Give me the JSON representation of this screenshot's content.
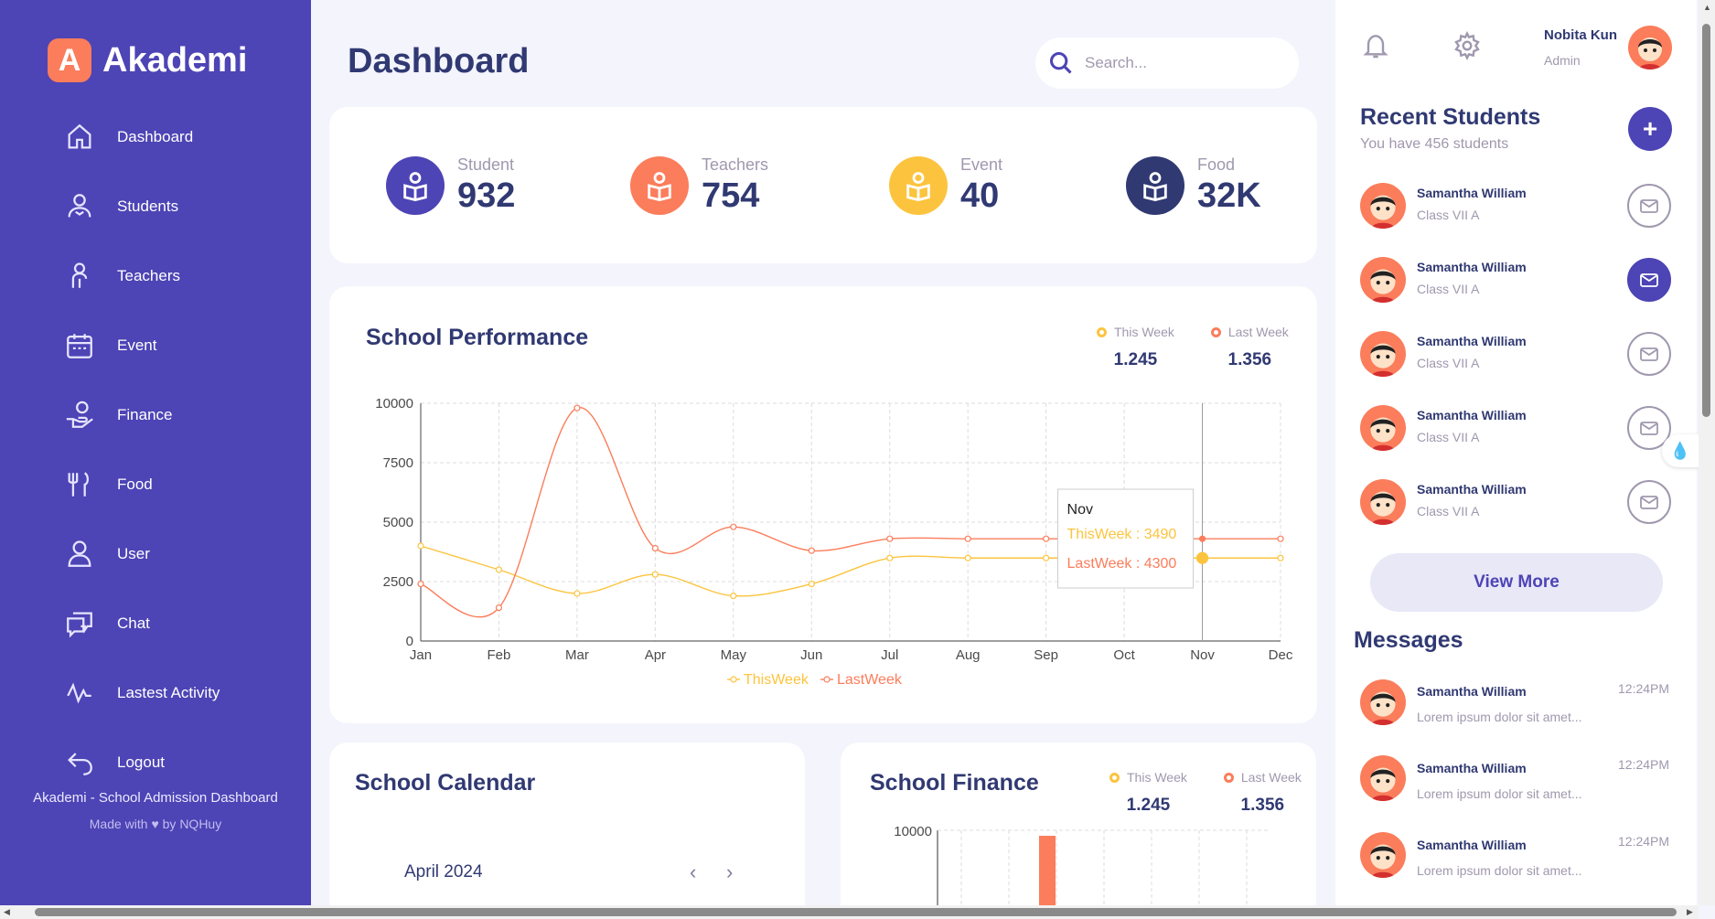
{
  "brand": {
    "logo_letter": "A",
    "name": "Akademi"
  },
  "nav": [
    {
      "label": "Dashboard",
      "icon": "home-icon"
    },
    {
      "label": "Students",
      "icon": "student-icon"
    },
    {
      "label": "Teachers",
      "icon": "teacher-icon"
    },
    {
      "label": "Event",
      "icon": "calendar-icon"
    },
    {
      "label": "Finance",
      "icon": "finance-icon"
    },
    {
      "label": "Food",
      "icon": "food-icon"
    },
    {
      "label": "User",
      "icon": "user-icon"
    },
    {
      "label": "Chat",
      "icon": "chat-icon"
    },
    {
      "label": "Lastest Activity",
      "icon": "activity-icon"
    },
    {
      "label": "Logout",
      "icon": "logout-icon"
    }
  ],
  "sidebar_footer": {
    "title": "Akademi - School Admission Dashboard",
    "made": "Made with ♥ by NQHuy"
  },
  "header": {
    "title": "Dashboard",
    "search_placeholder": "Search..."
  },
  "stats": [
    {
      "label": "Student",
      "value": "932",
      "color": "#4d44b5"
    },
    {
      "label": "Teachers",
      "value": "754",
      "color": "#fb7d5b"
    },
    {
      "label": "Event",
      "value": "40",
      "color": "#fcc43e"
    },
    {
      "label": "Food",
      "value": "32K",
      "color": "#303972"
    }
  ],
  "performance": {
    "title": "School Performance",
    "legend": [
      {
        "label": "This Week",
        "value": "1.245",
        "color": "#fcc43e"
      },
      {
        "label": "Last Week",
        "value": "1.356",
        "color": "#fb7d5b"
      }
    ],
    "tooltip": {
      "month": "Nov",
      "this_week": "ThisWeek : 3490",
      "last_week": "LastWeek : 4300"
    }
  },
  "chart_data": {
    "type": "line",
    "categories": [
      "Jan",
      "Feb",
      "Mar",
      "Apr",
      "May",
      "Jun",
      "Jul",
      "Aug",
      "Sep",
      "Oct",
      "Nov",
      "Dec"
    ],
    "series": [
      {
        "name": "ThisWeek",
        "color": "#fcc43e",
        "values": [
          4000,
          3000,
          2000,
          2800,
          1900,
          2400,
          3490,
          3490,
          3490,
          3490,
          3490,
          3490
        ]
      },
      {
        "name": "LastWeek",
        "color": "#fb7d5b",
        "values": [
          2400,
          1400,
          9800,
          3900,
          4800,
          3800,
          4300,
          4300,
          4300,
          4300,
          4300,
          4300
        ]
      }
    ],
    "yticks": [
      "0",
      "2500",
      "5000",
      "7500",
      "10000"
    ],
    "ylim": [
      0,
      10000
    ],
    "grid": true,
    "legend": "bottom"
  },
  "calendar": {
    "title": "School Calendar",
    "month": "April 2024",
    "prev": "‹",
    "next": "›"
  },
  "finance": {
    "title": "School Finance",
    "legend": [
      {
        "label": "This Week",
        "value": "1.245",
        "color": "#fcc43e"
      },
      {
        "label": "Last Week",
        "value": "1.356",
        "color": "#fb7d5b"
      }
    ],
    "ytick": "10000"
  },
  "user": {
    "name": "Nobita Kun",
    "role": "Admin"
  },
  "recent": {
    "title": "Recent Students",
    "subtitle": "You have 456 students",
    "add": "+",
    "students": [
      {
        "name": "Samantha William",
        "class": "Class VII A"
      },
      {
        "name": "Samantha William",
        "class": "Class VII A"
      },
      {
        "name": "Samantha William",
        "class": "Class VII A"
      },
      {
        "name": "Samantha William",
        "class": "Class VII A"
      },
      {
        "name": "Samantha William",
        "class": "Class VII A"
      }
    ],
    "view_more": "View More"
  },
  "messages": {
    "title": "Messages",
    "items": [
      {
        "name": "Samantha William",
        "text": "Lorem ipsum dolor sit amet...",
        "time": "12:24PM"
      },
      {
        "name": "Samantha William",
        "text": "Lorem ipsum dolor sit amet...",
        "time": "12:24PM"
      },
      {
        "name": "Samantha William",
        "text": "Lorem ipsum dolor sit amet...",
        "time": "12:24PM"
      }
    ]
  }
}
